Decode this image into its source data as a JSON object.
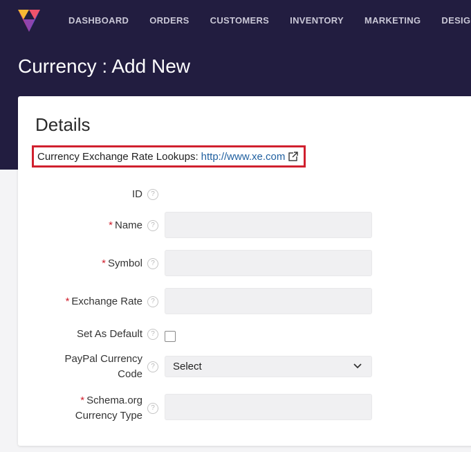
{
  "nav": {
    "items": [
      "DASHBOARD",
      "ORDERS",
      "CUSTOMERS",
      "INVENTORY",
      "MARKETING",
      "DESIGN"
    ]
  },
  "page": {
    "title": "Currency : Add New"
  },
  "card": {
    "title": "Details",
    "lookup_label": "Currency Exchange Rate Lookups:",
    "lookup_link": "http://www.xe.com"
  },
  "form": {
    "required_marker": "*",
    "help_glyph": "?",
    "id_label": "ID",
    "name_label": "Name",
    "name_value": "",
    "symbol_label": "Symbol",
    "symbol_value": "",
    "rate_label": "Exchange Rate",
    "rate_value": "",
    "default_label": "Set As Default",
    "default_checked": false,
    "paypal_label_1": "PayPal Currency",
    "paypal_label_2": "Code",
    "paypal_value": "Select",
    "schema_label_1": "Schema.org",
    "schema_label_2": "Currency Type",
    "schema_value": ""
  },
  "colors": {
    "header_bg": "#221d40",
    "highlight_border": "#d0202e",
    "link": "#1f5f9f",
    "required": "#d0202e"
  },
  "icons": {
    "logo": "brand-logo-icon",
    "external": "external-link-icon",
    "help": "help-circle-icon",
    "dropdown": "chevron-down-icon"
  }
}
